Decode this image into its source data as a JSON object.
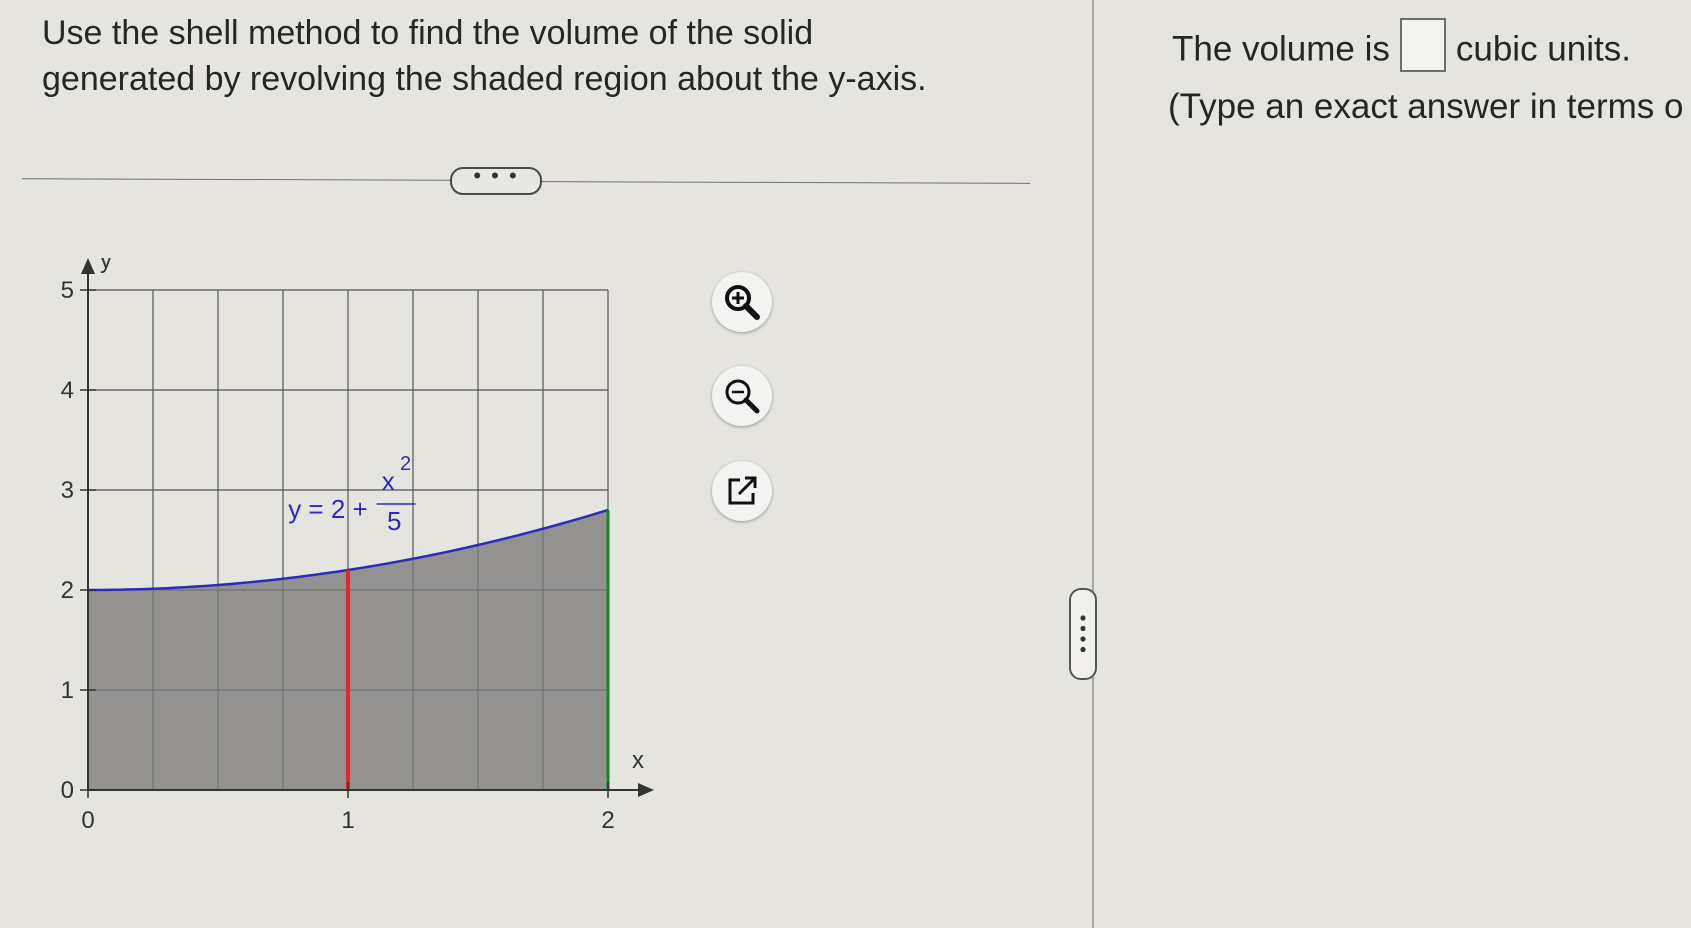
{
  "question": {
    "line1": "Use the shell method to find the volume of the solid",
    "line2": "generated by revolving the shaded region about the y-axis."
  },
  "more_pill": {
    "label": "• • •"
  },
  "chart_data": {
    "type": "area",
    "function_label": {
      "lhs": "y = 2 +",
      "num": "x",
      "exp": "2",
      "den": "5"
    },
    "x_axis_label": "x",
    "y_axis_label": "y",
    "xlim": [
      0,
      2
    ],
    "ylim": [
      0,
      5
    ],
    "x_ticks": [
      0,
      1,
      2
    ],
    "y_ticks": [
      0,
      1,
      2,
      3,
      4,
      5
    ],
    "grid": true,
    "grid_step_x": 0.25,
    "grid_step_y": 1,
    "curve": [
      [
        0,
        2.0
      ],
      [
        0.25,
        2.0125
      ],
      [
        0.5,
        2.05
      ],
      [
        0.75,
        2.1125
      ],
      [
        1.0,
        2.2
      ],
      [
        1.25,
        2.3125
      ],
      [
        1.5,
        2.45
      ],
      [
        1.75,
        2.6125
      ],
      [
        2.0,
        2.8
      ]
    ],
    "shaded_region": "0 <= x <= 2, 0 <= y <= 2 + x^2/5",
    "colors": {
      "curve": "#2b2bbd",
      "shell_line": "#e3262c",
      "right_boundary": "#138a2a",
      "shade": "#7b7b7b"
    },
    "shell_line_x": 1,
    "right_boundary_x": 2
  },
  "tools": {
    "zoom_in": {
      "icon": "zoom-in-icon"
    },
    "zoom_out": {
      "icon": "zoom-out-icon"
    },
    "open_new": {
      "icon": "open-external-icon"
    }
  },
  "answer": {
    "prefix": "The volume is",
    "suffix": "cubic units.",
    "value": "",
    "instruction": "(Type an exact answer in terms o"
  }
}
